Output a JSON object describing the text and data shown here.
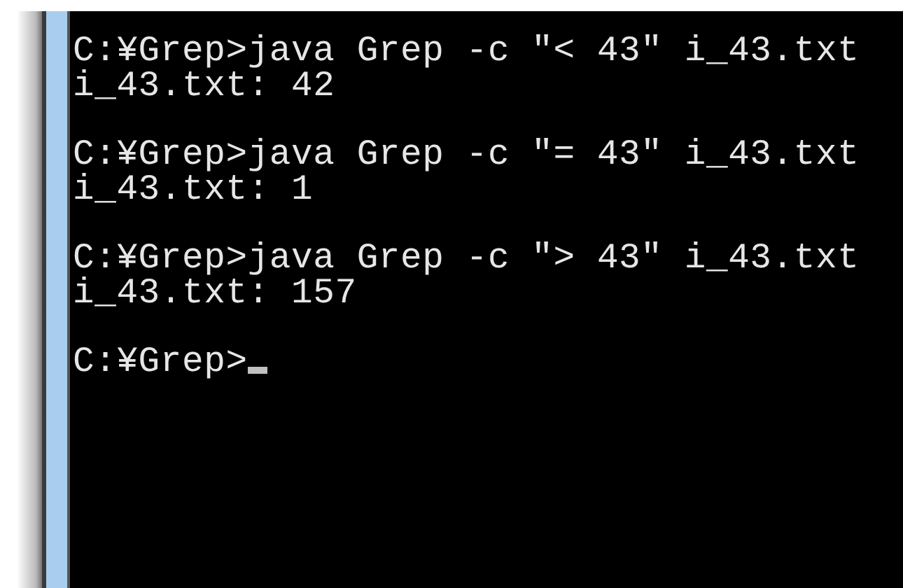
{
  "console": {
    "lines": [
      {
        "kind": "command",
        "text": "C:¥Grep>java Grep -c \"< 43\" i_43.txt"
      },
      {
        "kind": "output",
        "text": "i_43.txt: 42"
      },
      {
        "kind": "command",
        "text": "C:¥Grep>java Grep -c \"= 43\" i_43.txt"
      },
      {
        "kind": "output",
        "text": "i_43.txt: 1"
      },
      {
        "kind": "command",
        "text": "C:¥Grep>java Grep -c \"> 43\" i_43.txt"
      },
      {
        "kind": "output",
        "text": "i_43.txt: 157"
      },
      {
        "kind": "prompt",
        "text": "C:¥Grep>"
      }
    ]
  }
}
